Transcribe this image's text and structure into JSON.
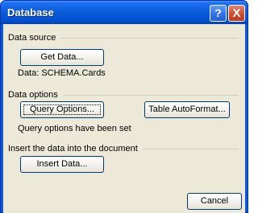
{
  "window": {
    "title": "Database",
    "help_glyph": "?",
    "close_glyph": "X"
  },
  "data_source": {
    "header": "Data source",
    "get_data_label": "Get Data...",
    "status": "Data: SCHEMA.Cards"
  },
  "data_options": {
    "header": "Data options",
    "query_options_label": "Query Options...",
    "table_autoformat_label": "Table AutoFormat...",
    "status": "Query options have been set"
  },
  "insert": {
    "header": "Insert the data into the document",
    "insert_data_label": "Insert Data..."
  },
  "footer": {
    "cancel_label": "Cancel"
  }
}
